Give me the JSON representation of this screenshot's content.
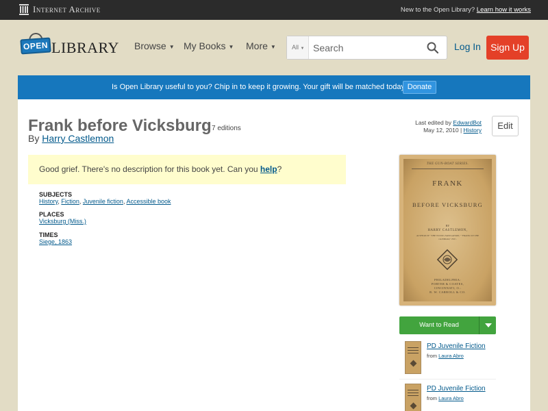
{
  "ia_bar": {
    "logo_text": "Internet Archive",
    "prompt": "New to the Open Library?",
    "learn_link": "Learn how it works"
  },
  "header": {
    "logo_open": "OPEN",
    "logo_library": "LIBRARY",
    "nav": [
      {
        "label": "Browse"
      },
      {
        "label": "My Books"
      },
      {
        "label": "More"
      }
    ],
    "search": {
      "scope": "All",
      "placeholder": "Search"
    },
    "login_label": "Log In",
    "signup_label": "Sign Up"
  },
  "donate": {
    "text": "Is Open Library useful to you? Chip in to keep it growing. Your gift will be matched today!",
    "button_label": "Donate"
  },
  "book": {
    "title": "Frank before Vicksburg",
    "editions": "7 editions",
    "by_prefix": "By",
    "author": "Harry Castlemon",
    "last_edited_prefix": "Last edited by",
    "last_edited_by": "EdwardBot",
    "last_edited_date": "May 12, 2010",
    "history_link": "History",
    "edit_label": "Edit",
    "no_description_prefix": "Good grief. There's no description for this book yet. Can you",
    "no_description_link": "help",
    "no_description_suffix": "?",
    "subjects": {
      "heading": "Subjects",
      "items": [
        "History",
        "Fiction",
        "Juvenile fiction",
        "Accessible book"
      ]
    },
    "places": {
      "heading": "Places",
      "items": [
        "Vicksburg (Miss.)"
      ]
    },
    "times": {
      "heading": "Times",
      "items": [
        "Siege, 1863"
      ]
    }
  },
  "cover": {
    "series": "THE GUN-BOAT SERIES.",
    "title_line1": "FRANK",
    "title_line2": "BEFORE VICKSBURG",
    "by": "BY",
    "author": "HARRY CASTLEMON,",
    "author_note": "AUTHOR OF \"THE YOUNG NAVIGATORS,\" \"FRANK ON THE GUNBOAT,\" ETC.",
    "pub_line1": "PHILADELPHIA:",
    "pub_line2": "PORTER & COATES,",
    "pub_line3": "CINCINNATI, O.:",
    "pub_line4": "R. W. CARROLL & CO."
  },
  "want_to_read": {
    "label": "Want to Read"
  },
  "lists": [
    {
      "title": "PD Juvenile Fiction",
      "from_prefix": "from",
      "author": "Laura Abro"
    },
    {
      "title": "PD Juvenile Fiction",
      "from_prefix": "from",
      "author": "Laura Abro"
    }
  ],
  "colors": {
    "ia_bar": "#2b2b2b",
    "page_bg": "#e2dcc5",
    "donate_bar": "#1677bd",
    "signup": "#e44028",
    "want_to_read": "#42a43e",
    "link": "#02598b"
  }
}
